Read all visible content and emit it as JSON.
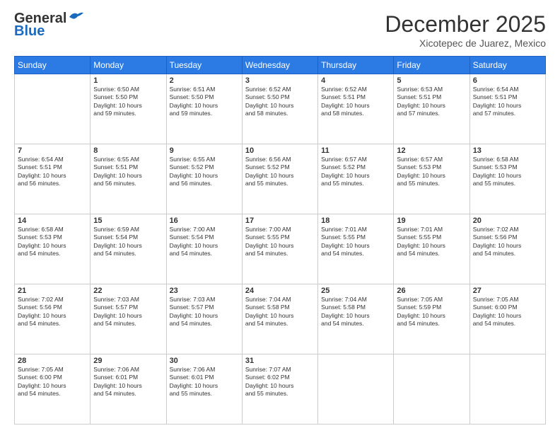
{
  "header": {
    "logo_general": "General",
    "logo_blue": "Blue",
    "month_title": "December 2025",
    "location": "Xicotepec de Juarez, Mexico"
  },
  "days_of_week": [
    "Sunday",
    "Monday",
    "Tuesday",
    "Wednesday",
    "Thursday",
    "Friday",
    "Saturday"
  ],
  "weeks": [
    [
      {
        "day": "",
        "content": ""
      },
      {
        "day": "1",
        "content": "Sunrise: 6:50 AM\nSunset: 5:50 PM\nDaylight: 10 hours\nand 59 minutes."
      },
      {
        "day": "2",
        "content": "Sunrise: 6:51 AM\nSunset: 5:50 PM\nDaylight: 10 hours\nand 59 minutes."
      },
      {
        "day": "3",
        "content": "Sunrise: 6:52 AM\nSunset: 5:50 PM\nDaylight: 10 hours\nand 58 minutes."
      },
      {
        "day": "4",
        "content": "Sunrise: 6:52 AM\nSunset: 5:51 PM\nDaylight: 10 hours\nand 58 minutes."
      },
      {
        "day": "5",
        "content": "Sunrise: 6:53 AM\nSunset: 5:51 PM\nDaylight: 10 hours\nand 57 minutes."
      },
      {
        "day": "6",
        "content": "Sunrise: 6:54 AM\nSunset: 5:51 PM\nDaylight: 10 hours\nand 57 minutes."
      }
    ],
    [
      {
        "day": "7",
        "content": "Sunrise: 6:54 AM\nSunset: 5:51 PM\nDaylight: 10 hours\nand 56 minutes."
      },
      {
        "day": "8",
        "content": "Sunrise: 6:55 AM\nSunset: 5:51 PM\nDaylight: 10 hours\nand 56 minutes."
      },
      {
        "day": "9",
        "content": "Sunrise: 6:55 AM\nSunset: 5:52 PM\nDaylight: 10 hours\nand 56 minutes."
      },
      {
        "day": "10",
        "content": "Sunrise: 6:56 AM\nSunset: 5:52 PM\nDaylight: 10 hours\nand 55 minutes."
      },
      {
        "day": "11",
        "content": "Sunrise: 6:57 AM\nSunset: 5:52 PM\nDaylight: 10 hours\nand 55 minutes."
      },
      {
        "day": "12",
        "content": "Sunrise: 6:57 AM\nSunset: 5:53 PM\nDaylight: 10 hours\nand 55 minutes."
      },
      {
        "day": "13",
        "content": "Sunrise: 6:58 AM\nSunset: 5:53 PM\nDaylight: 10 hours\nand 55 minutes."
      }
    ],
    [
      {
        "day": "14",
        "content": "Sunrise: 6:58 AM\nSunset: 5:53 PM\nDaylight: 10 hours\nand 54 minutes."
      },
      {
        "day": "15",
        "content": "Sunrise: 6:59 AM\nSunset: 5:54 PM\nDaylight: 10 hours\nand 54 minutes."
      },
      {
        "day": "16",
        "content": "Sunrise: 7:00 AM\nSunset: 5:54 PM\nDaylight: 10 hours\nand 54 minutes."
      },
      {
        "day": "17",
        "content": "Sunrise: 7:00 AM\nSunset: 5:55 PM\nDaylight: 10 hours\nand 54 minutes."
      },
      {
        "day": "18",
        "content": "Sunrise: 7:01 AM\nSunset: 5:55 PM\nDaylight: 10 hours\nand 54 minutes."
      },
      {
        "day": "19",
        "content": "Sunrise: 7:01 AM\nSunset: 5:55 PM\nDaylight: 10 hours\nand 54 minutes."
      },
      {
        "day": "20",
        "content": "Sunrise: 7:02 AM\nSunset: 5:56 PM\nDaylight: 10 hours\nand 54 minutes."
      }
    ],
    [
      {
        "day": "21",
        "content": "Sunrise: 7:02 AM\nSunset: 5:56 PM\nDaylight: 10 hours\nand 54 minutes."
      },
      {
        "day": "22",
        "content": "Sunrise: 7:03 AM\nSunset: 5:57 PM\nDaylight: 10 hours\nand 54 minutes."
      },
      {
        "day": "23",
        "content": "Sunrise: 7:03 AM\nSunset: 5:57 PM\nDaylight: 10 hours\nand 54 minutes."
      },
      {
        "day": "24",
        "content": "Sunrise: 7:04 AM\nSunset: 5:58 PM\nDaylight: 10 hours\nand 54 minutes."
      },
      {
        "day": "25",
        "content": "Sunrise: 7:04 AM\nSunset: 5:58 PM\nDaylight: 10 hours\nand 54 minutes."
      },
      {
        "day": "26",
        "content": "Sunrise: 7:05 AM\nSunset: 5:59 PM\nDaylight: 10 hours\nand 54 minutes."
      },
      {
        "day": "27",
        "content": "Sunrise: 7:05 AM\nSunset: 6:00 PM\nDaylight: 10 hours\nand 54 minutes."
      }
    ],
    [
      {
        "day": "28",
        "content": "Sunrise: 7:05 AM\nSunset: 6:00 PM\nDaylight: 10 hours\nand 54 minutes."
      },
      {
        "day": "29",
        "content": "Sunrise: 7:06 AM\nSunset: 6:01 PM\nDaylight: 10 hours\nand 54 minutes."
      },
      {
        "day": "30",
        "content": "Sunrise: 7:06 AM\nSunset: 6:01 PM\nDaylight: 10 hours\nand 55 minutes."
      },
      {
        "day": "31",
        "content": "Sunrise: 7:07 AM\nSunset: 6:02 PM\nDaylight: 10 hours\nand 55 minutes."
      },
      {
        "day": "",
        "content": ""
      },
      {
        "day": "",
        "content": ""
      },
      {
        "day": "",
        "content": ""
      }
    ]
  ]
}
